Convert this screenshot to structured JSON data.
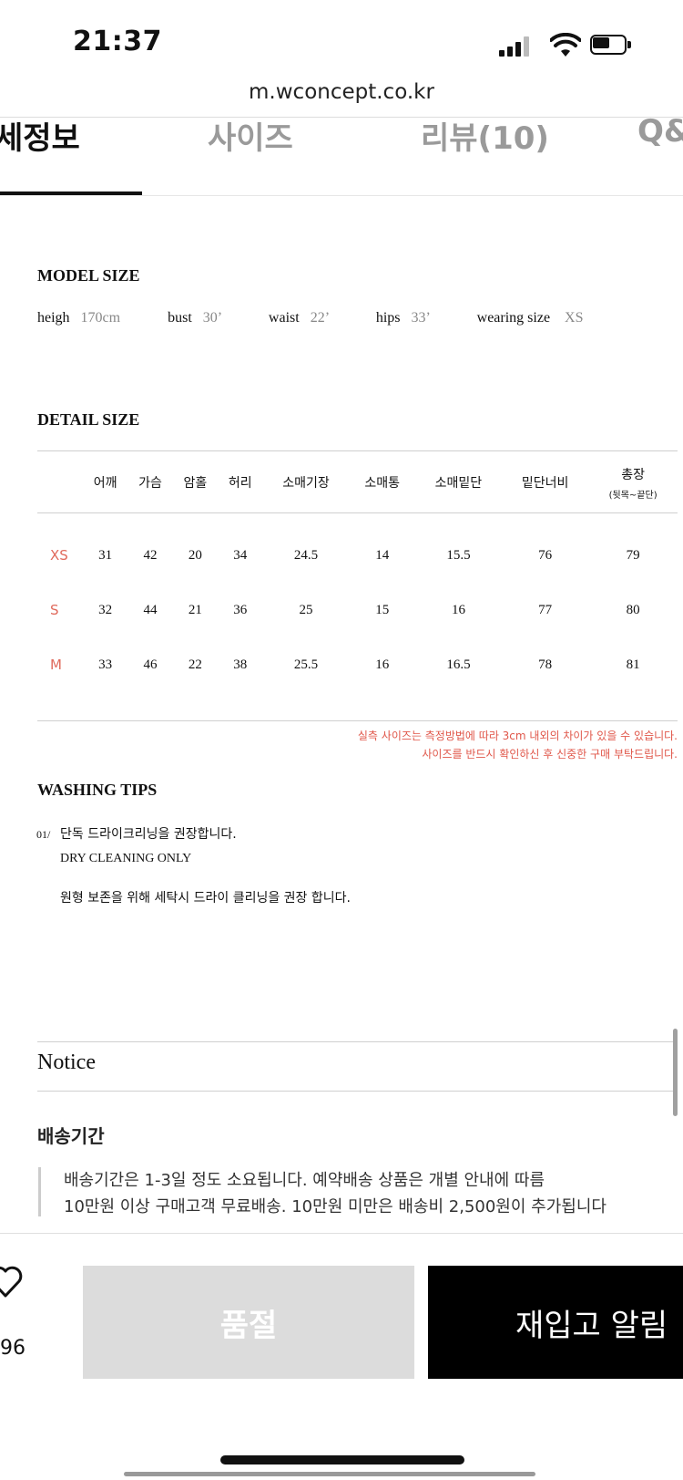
{
  "status_bar": {
    "time": "21:37",
    "signal_icon": "signal-icon",
    "wifi_icon": "wifi-icon",
    "battery_icon": "battery-icon"
  },
  "browser": {
    "url": "m.wconcept.co.kr"
  },
  "tabs": [
    {
      "label": "세정보",
      "active": true
    },
    {
      "label": "사이즈",
      "active": false
    },
    {
      "label": "리뷰(10)",
      "active": false
    },
    {
      "label": "Q&",
      "active": false
    }
  ],
  "model_size": {
    "title": "MODEL SIZE",
    "fields": [
      {
        "key": "heigh",
        "value": "170cm"
      },
      {
        "key": "bust",
        "value": "30’"
      },
      {
        "key": "waist",
        "value": "22’"
      },
      {
        "key": "hips",
        "value": "33’"
      },
      {
        "key": "wearing size",
        "value": "XS"
      }
    ]
  },
  "detail_size": {
    "title": "DETAIL SIZE",
    "headers": [
      "",
      "어깨",
      "가슴",
      "암홀",
      "허리",
      "소매기장",
      "소매통",
      "소매밑단",
      "밑단너비",
      "총장"
    ],
    "header_note": "(뒷목~끝단)",
    "rows": [
      {
        "size": "XS",
        "values": [
          "31",
          "42",
          "20",
          "34",
          "24.5",
          "14",
          "15.5",
          "76",
          "79"
        ]
      },
      {
        "size": "S",
        "values": [
          "32",
          "44",
          "21",
          "36",
          "25",
          "15",
          "16",
          "77",
          "80"
        ]
      },
      {
        "size": "M",
        "values": [
          "33",
          "46",
          "22",
          "38",
          "25.5",
          "16",
          "16.5",
          "78",
          "81"
        ]
      }
    ],
    "notes": [
      "실측 사이즈는 측정방법에 따라 3cm 내외의 차이가 있을 수 있습니다.",
      "사이즈를 반드시 확인하신 후 신중한 구매 부탁드립니다."
    ]
  },
  "washing_tips": {
    "title": "WASHING TIPS",
    "number": "01/",
    "lines": [
      "단독 드라이크리닝을 권장합니다.",
      "DRY CLEANING ONLY",
      "원형 보존을 위해 세탁시 드라이 클리닝을 권장 합니다."
    ]
  },
  "notice": {
    "title": "Notice",
    "shipping_title": "배송기간",
    "shipping_lines": [
      "배송기간은 1-3일 정도 소요됩니다. 예약배송 상품은 개별 안내에 따름",
      "10만원 이상 구매고객 무료배송. 10만원 미만은 배송비 2,500원이 추가됩니다"
    ]
  },
  "bottom_bar": {
    "like_icon": "heart-icon",
    "like_count": "96",
    "soldout_label": "품절",
    "restock_label": "재입고 알림"
  }
}
